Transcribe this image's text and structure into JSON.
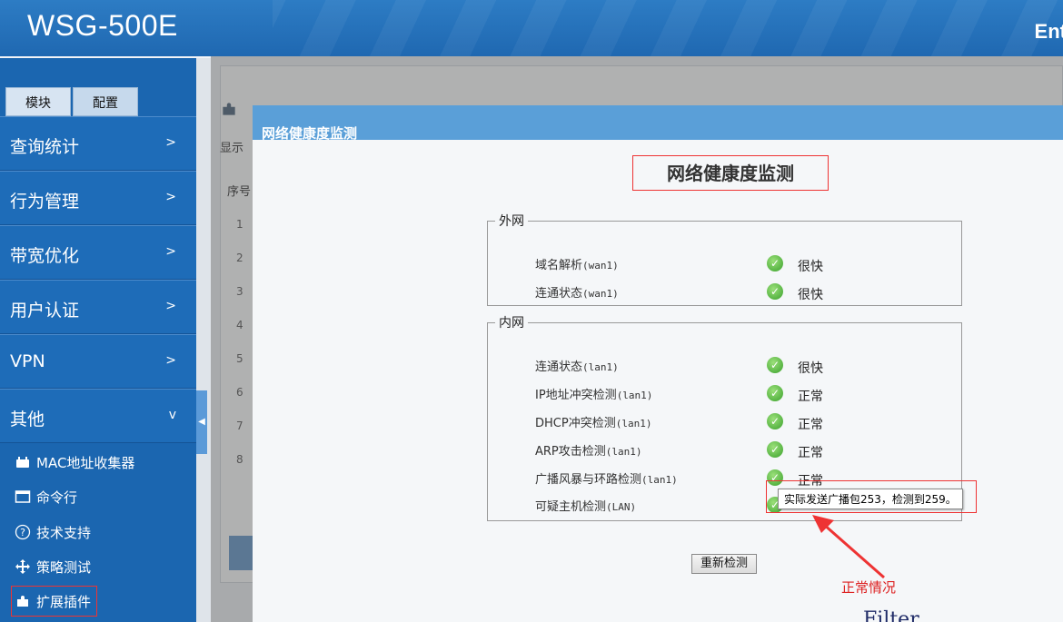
{
  "app": {
    "logo": "WSG-500E",
    "header_right": "Ent"
  },
  "sidebar": {
    "tabs": [
      "模块",
      "配置"
    ],
    "menu": [
      {
        "label": "查询统计",
        "chevron": ">"
      },
      {
        "label": "行为管理",
        "chevron": ">"
      },
      {
        "label": "带宽优化",
        "chevron": ">"
      },
      {
        "label": "用户认证",
        "chevron": ">"
      },
      {
        "label": "VPN",
        "chevron": ">"
      },
      {
        "label": "其他",
        "chevron": "v"
      }
    ],
    "subitems": [
      {
        "label": "MAC地址收集器",
        "icon": "mac-collector-icon"
      },
      {
        "label": "命令行",
        "icon": "terminal-icon"
      },
      {
        "label": "技术支持",
        "icon": "help-circle-icon"
      },
      {
        "label": "策略测试",
        "icon": "move-arrows-icon"
      },
      {
        "label": "扩展插件",
        "icon": "puzzle-icon"
      }
    ]
  },
  "background": {
    "show_label": "显示",
    "col_header": "序号",
    "rows": [
      "1",
      "2",
      "3",
      "4",
      "5",
      "6",
      "7",
      "8"
    ]
  },
  "dialog": {
    "title": "网络健康度监测",
    "heading": "网络健康度监测",
    "wan": {
      "legend": "外网",
      "items": [
        {
          "label": "域名解析",
          "iface": "(wan1)",
          "status": "很快"
        },
        {
          "label": "连通状态",
          "iface": "(wan1)",
          "status": "很快"
        }
      ]
    },
    "lan": {
      "legend": "内网",
      "items": [
        {
          "label": "连通状态",
          "iface": "(lan1)",
          "status": "很快"
        },
        {
          "label": "IP地址冲突检测",
          "iface": "(lan1)",
          "status": "正常"
        },
        {
          "label": "DHCP冲突检测",
          "iface": "(lan1)",
          "status": "正常"
        },
        {
          "label": "ARP攻击检测",
          "iface": "(lan1)",
          "status": "正常"
        },
        {
          "label": "广播风暴与环路检测",
          "iface": "(lan1)",
          "status": "正常"
        },
        {
          "label": "可疑主机检测",
          "iface": "(LAN)",
          "status": ""
        }
      ]
    },
    "tooltip": "实际发送广播包253，检测到259。",
    "recheck_button": "重新检测",
    "annotation": "正常情况"
  },
  "watermark": "Filter",
  "colors": {
    "header": "#1f68b1",
    "sidebar": "#1b66b0",
    "dialog_title": "#5a9fd8",
    "annotation": "#dd2222"
  }
}
